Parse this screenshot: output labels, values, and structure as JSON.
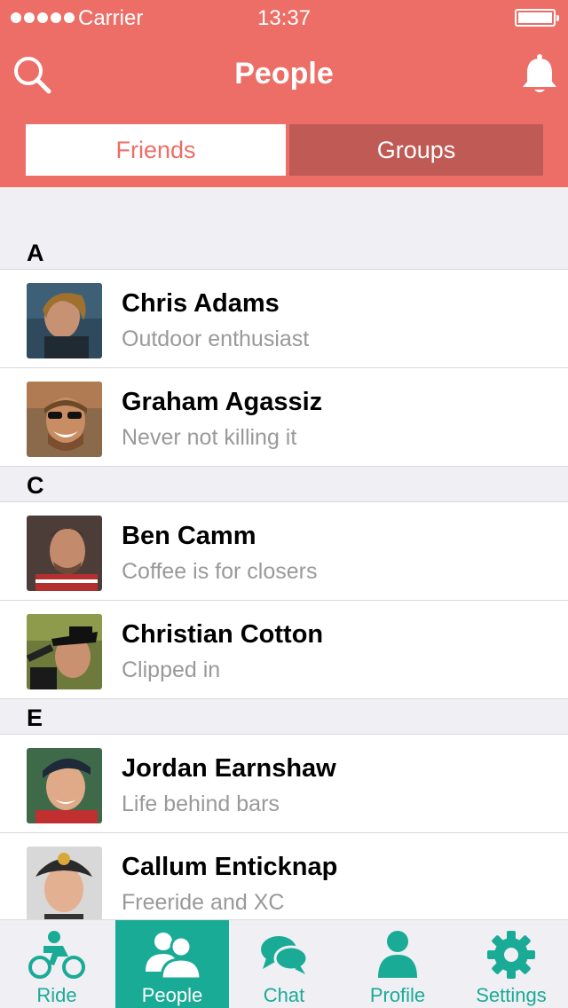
{
  "status_bar": {
    "carrier": "Carrier",
    "time": "13:37"
  },
  "header": {
    "title": "People",
    "color": "#ec6e66",
    "search_icon": "search-icon",
    "notification_icon": "bell-icon"
  },
  "segments": {
    "friends": "Friends",
    "groups": "Groups",
    "selected": "Friends"
  },
  "sections": [
    {
      "letter": "A",
      "people": [
        {
          "name": "Chris Adams",
          "status": "Outdoor enthusiast"
        },
        {
          "name": "Graham Agassiz",
          "status": "Never not killing it"
        }
      ]
    },
    {
      "letter": "C",
      "people": [
        {
          "name": "Ben Camm",
          "status": "Coffee is for closers"
        },
        {
          "name": "Christian Cotton",
          "status": "Clipped in"
        }
      ]
    },
    {
      "letter": "E",
      "people": [
        {
          "name": "Jordan Earnshaw",
          "status": "Life behind bars"
        },
        {
          "name": "Callum Enticknap",
          "status": "Freeride and XC"
        }
      ]
    }
  ],
  "tabbar": {
    "accent": "#1aab96",
    "active": "People",
    "tabs": [
      {
        "label": "Ride",
        "icon": "cyclist-icon"
      },
      {
        "label": "People",
        "icon": "people-icon"
      },
      {
        "label": "Chat",
        "icon": "chat-bubbles-icon"
      },
      {
        "label": "Profile",
        "icon": "person-icon"
      },
      {
        "label": "Settings",
        "icon": "gear-icon"
      }
    ]
  }
}
